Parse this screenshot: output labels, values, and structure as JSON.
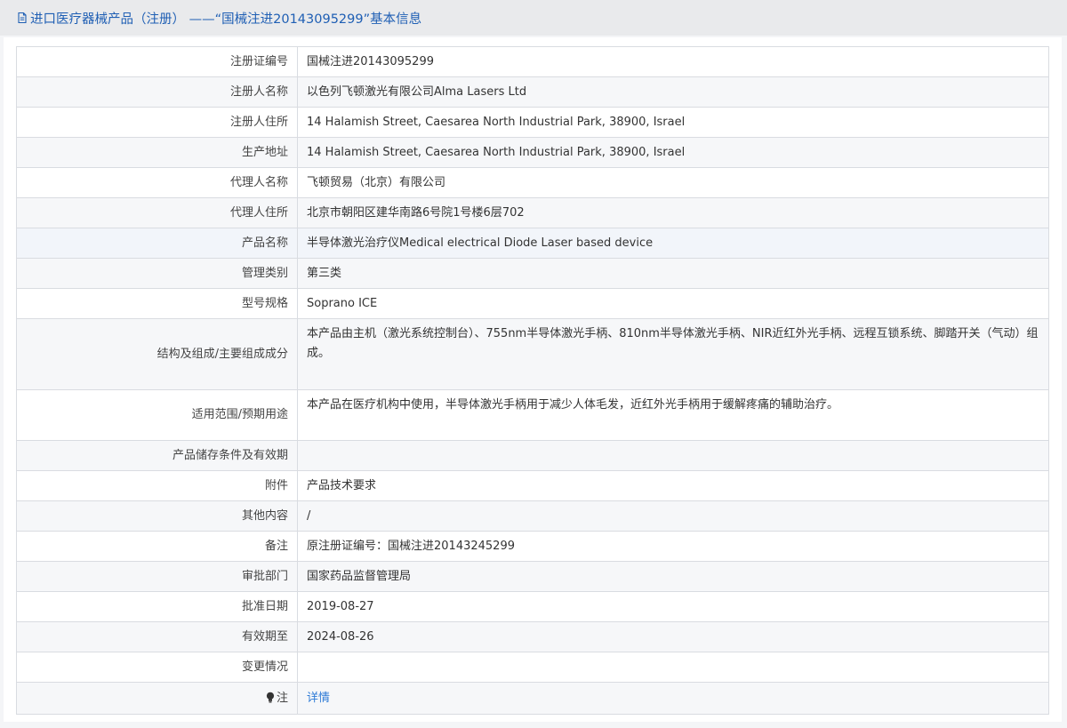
{
  "header": {
    "title": "进口医疗器械产品（注册） ——“国械注进20143095299”基本信息"
  },
  "rows": [
    {
      "label": "注册证编号",
      "value": "国械注进20143095299"
    },
    {
      "label": "注册人名称",
      "value": "以色列飞顿激光有限公司Alma Lasers Ltd"
    },
    {
      "label": "注册人住所",
      "value": "14 Halamish Street, Caesarea North Industrial Park, 38900, Israel"
    },
    {
      "label": "生产地址",
      "value": "14 Halamish Street, Caesarea North Industrial Park, 38900, Israel"
    },
    {
      "label": "代理人名称",
      "value": "飞顿贸易（北京）有限公司"
    },
    {
      "label": "代理人住所",
      "value": "北京市朝阳区建华南路6号院1号楼6层702"
    },
    {
      "label": "产品名称",
      "value": "半导体激光治疗仪Medical electrical Diode Laser based device"
    },
    {
      "label": "管理类别",
      "value": "第三类"
    },
    {
      "label": "型号规格",
      "value": "Soprano ICE"
    },
    {
      "label": "结构及组成/主要组成成分",
      "value": "本产品由主机（激光系统控制台）、755nm半导体激光手柄、810nm半导体激光手柄、NIR近红外光手柄、远程互锁系统、脚踏开关（气动）组成。"
    },
    {
      "label": "适用范围/预期用途",
      "value": "本产品在医疗机构中使用，半导体激光手柄用于减少人体毛发，近红外光手柄用于缓解疼痛的辅助治疗。"
    },
    {
      "label": "产品储存条件及有效期",
      "value": ""
    },
    {
      "label": "附件",
      "value": "产品技术要求"
    },
    {
      "label": "其他内容",
      "value": "/"
    },
    {
      "label": "备注",
      "value": "原注册证编号：国械注进20143245299"
    },
    {
      "label": "审批部门",
      "value": "国家药品监督管理局"
    },
    {
      "label": "批准日期",
      "value": "2019-08-27"
    },
    {
      "label": "有效期至",
      "value": "2024-08-26"
    },
    {
      "label": "变更情况",
      "value": ""
    }
  ],
  "note": {
    "label": "注",
    "link": "详情"
  },
  "colors": {
    "link": "#2d7ad6",
    "header_text": "#1f5fb4",
    "border": "#d9dce1"
  }
}
